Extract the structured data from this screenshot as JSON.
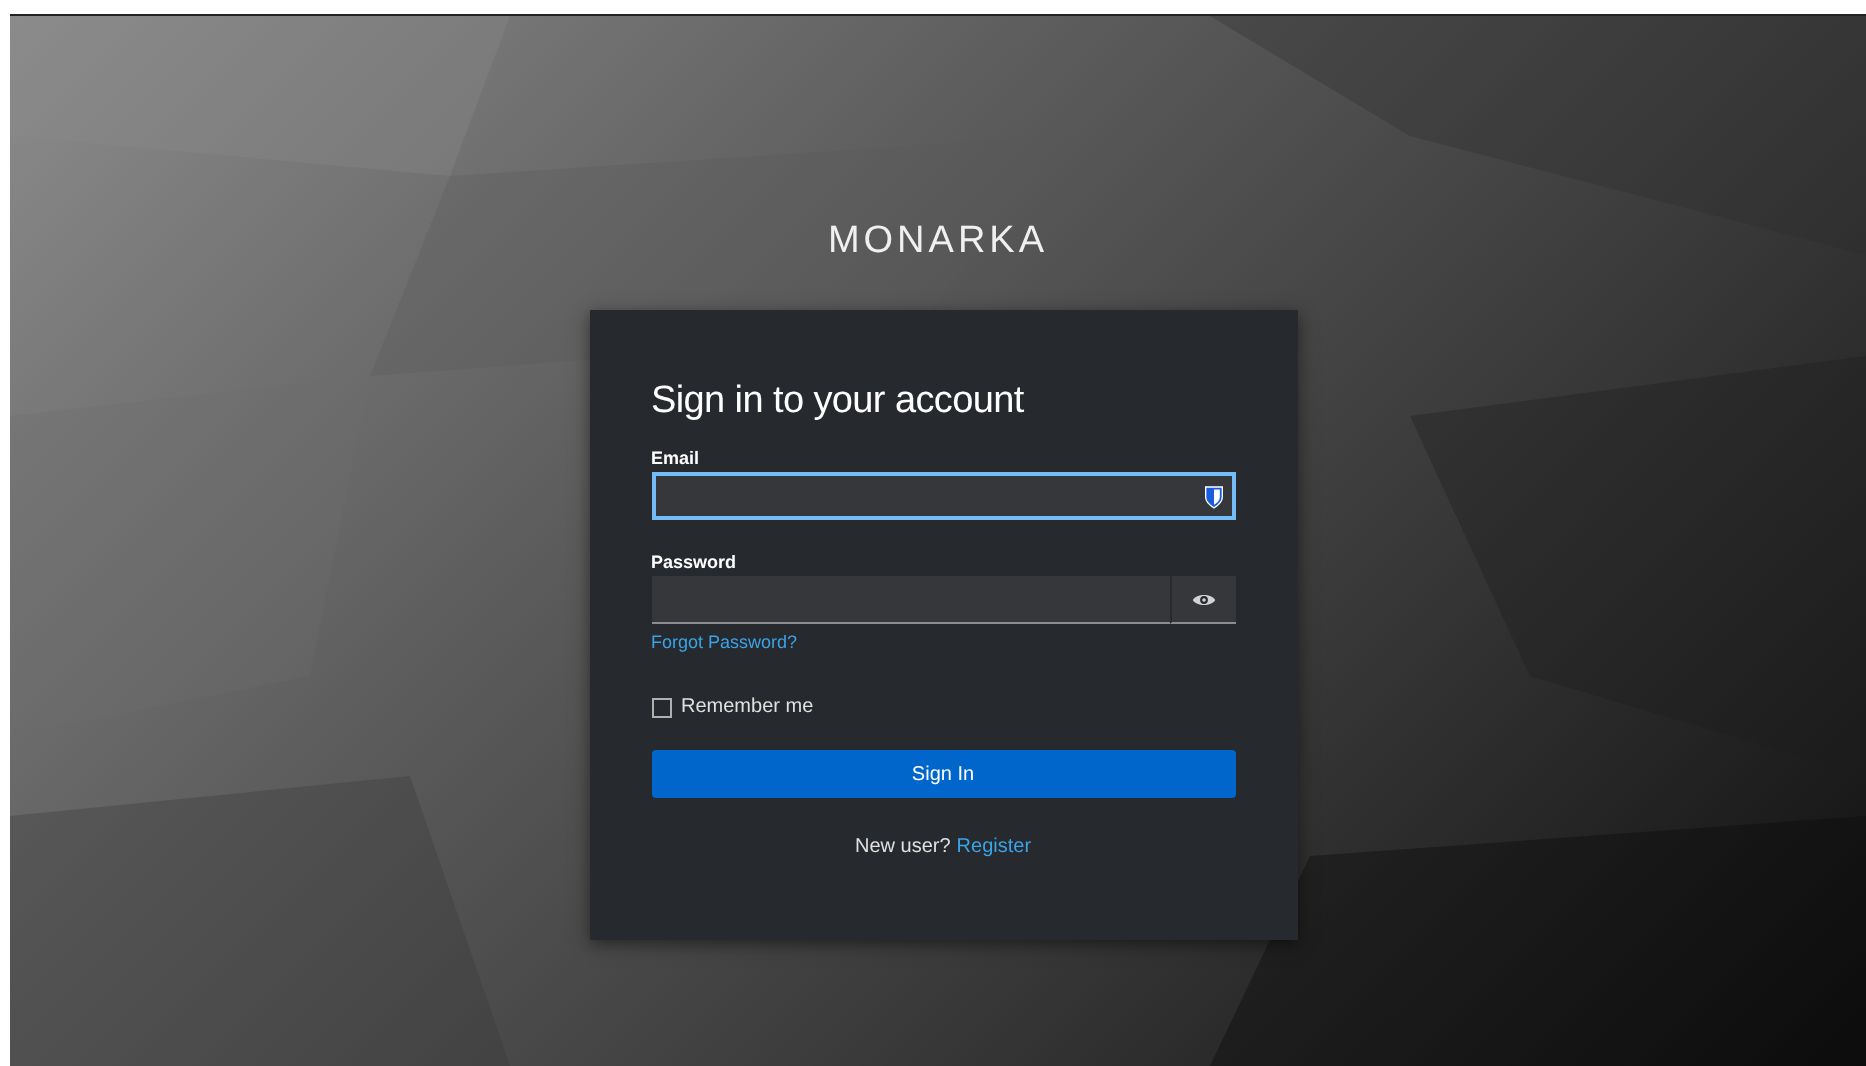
{
  "brand": "MONARKA",
  "login": {
    "title": "Sign in to your account",
    "email": {
      "label": "Email",
      "focused": true
    },
    "password": {
      "label": "Password",
      "focused": false
    },
    "forgot_link": "Forgot Password?",
    "remember": {
      "label": "Remember me",
      "checked": false
    },
    "submit": "Sign In",
    "register_prompt": "New user?",
    "register_link": "Register"
  }
}
